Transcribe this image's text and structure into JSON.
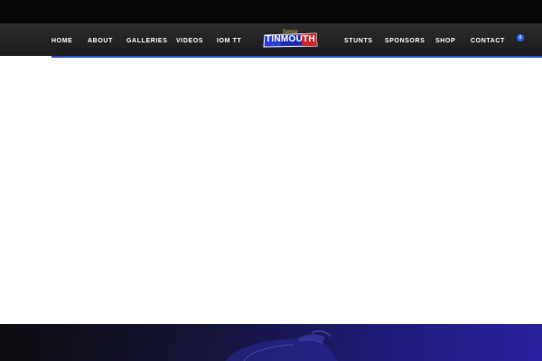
{
  "header": {
    "nav_left": [
      "HOME",
      "ABOUT",
      "GALLERIES",
      "VIDEOS",
      "IOM TT"
    ],
    "nav_right": [
      "STUNTS",
      "SPONSORS",
      "SHOP",
      "CONTACT"
    ],
    "logo": {
      "script": "Jamie",
      "wordmark": "TINMOUTH"
    },
    "cart_count": "0",
    "accent_color": "#2f55c9"
  },
  "icons": {
    "cart": "cart-badge-icon"
  },
  "hero": {
    "colors": [
      "#0d0d10",
      "#1f1a78",
      "#2a20a0"
    ]
  }
}
